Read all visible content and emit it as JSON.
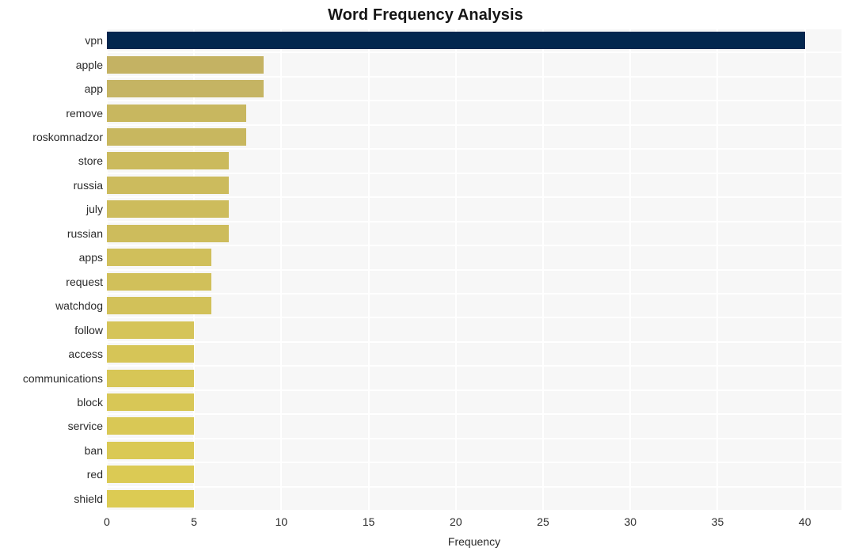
{
  "chart_data": {
    "type": "bar",
    "orientation": "horizontal",
    "title": "Word Frequency Analysis",
    "xlabel": "Frequency",
    "ylabel": "",
    "categories": [
      "vpn",
      "apple",
      "app",
      "remove",
      "roskomnadzor",
      "store",
      "russia",
      "july",
      "russian",
      "apps",
      "request",
      "watchdog",
      "follow",
      "access",
      "communications",
      "block",
      "service",
      "ban",
      "red",
      "shield"
    ],
    "values": [
      40,
      9,
      9,
      8,
      8,
      7,
      7,
      7,
      7,
      6,
      6,
      6,
      5,
      5,
      5,
      5,
      5,
      5,
      5,
      5
    ],
    "xlim": [
      0,
      42.1
    ],
    "xticks": [
      0,
      5,
      10,
      15,
      20,
      25,
      30,
      35,
      40
    ],
    "xticklabels": [
      "0",
      "5",
      "10",
      "15",
      "20",
      "25",
      "30",
      "35",
      "40"
    ],
    "grid": true,
    "grid_axis": "x",
    "legend": "none",
    "bar_colors": [
      "#03274f",
      "#c4b263",
      "#c5b463",
      "#c8b75f",
      "#c8b75f",
      "#cbba5d",
      "#ccbb5d",
      "#cdbc5c",
      "#cdbc5c",
      "#d0bf5b",
      "#d1c05a",
      "#d2c159",
      "#d5c459",
      "#d6c557",
      "#d7c656",
      "#d8c756",
      "#d9c855",
      "#dac954",
      "#dbca54",
      "#dccb53"
    ],
    "plot_background": "#f7f7f7",
    "gridline_color": "#ffffff",
    "figure_background": "#ffffff"
  }
}
